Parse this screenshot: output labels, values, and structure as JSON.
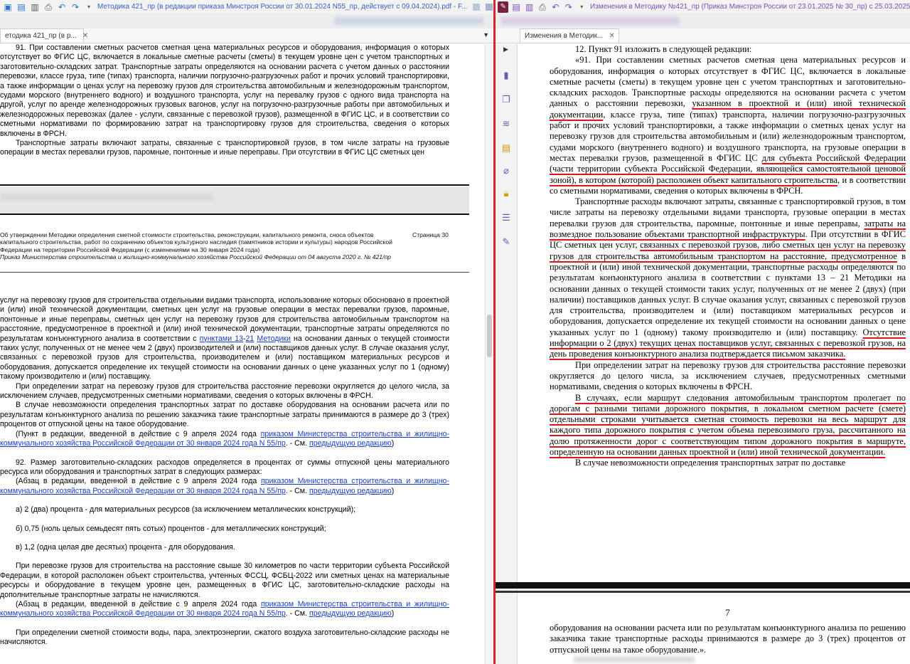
{
  "left": {
    "window_title": "Методика 421_пр (в редакции приказа Минстроя России от 30.01.2024 N55_пр, действует с 09.04.2024).pdf - F...",
    "tab_label": "етодика 421_пр (в р...",
    "page_top": {
      "p1": "91. При составлении сметных расчетов сметная цена материальных ресурсов и оборудования, информация о которых отсутствует во ФГИС ЦС, включается в локальные сметные расчеты (сметы) в текущем уровне цен с учетом транспортных и заготовительно-складских затрат. Транспортные затраты определяются на основании расчета с учетом данных о расстоянии перевозки, классе груза, типе (типах) транспорта, наличии погрузочно-разгрузочных работ и прочих условий транспортировки, а также информации о ценах услуг на перевозку грузов для строительства автомобильным и железнодорожным транспортом, судами морского (внутреннего водного) и воздушного транспорта, услуг на перевалку грузов с одного вида транспорта на другой, услуг по аренде железнодорожных грузовых вагонов, услуг на погрузочно-разгрузочные работы при автомобильных и железнодорожных перевозках (далее - услуги, связанные с перевозкой грузов), размещенной в ФГИС ЦС, и в соответствии со сметными нормативами по формированию затрат на транспортировку грузов для строительства, сведения о которых включены в ФРСН.",
      "p2": "Транспортные затраты включают затраты, связанные с транспортировкой грузов, в том числе затраты на грузовые операции в местах перевалки грузов, паромные, понтонные и иные переправы. При отсутствии в ФГИС ЦС сметных цен"
    },
    "header": {
      "line1": "Об утверждении Методики определения сметной стоимости строительства, реконструкции, капитального ремонта, сноса объектов капитального строительства, работ по сохранению объектов культурного наследия (памятников истории и культуры) народов Российской Федерации на территории Российской Федерации (с изменениями на 30 января 2024 года)",
      "page": "Страница 30",
      "line2": "Приказ Министерства строительства и жилищно-коммунального хозяйства Российской Федерации от 04 августа 2020 г. № 421/пр"
    },
    "body": {
      "p1_a": "услуг на перевозку грузов для строительства отдельными видами транспорта, использование которых обосновано в проектной и (или) иной технической документации, сметных цен услуг на грузовые операции в местах перевалки грузов, паромные, понтонные и иные переправы, сметных цен услуг на перевозку грузов для строительства автомобильным транспортом на расстояние, предусмотренное в проектной и (или) иной технической документации, транспортные затраты определяются по результатам конъюнктурного анализа в соответствии с ",
      "p1_link1": "пунктами 13",
      "p1_dash": "-",
      "p1_link2": "21",
      "p1_link3": "Методики",
      "p1_b": " на основании данных о текущей стоимости таких услуг, полученных от не менее чем 2 (двух) производителей и (или) поставщиков данных услуг. В случае оказания услуг, связанных с перевозкой грузов для строительства, производителем и (или) поставщиком материальных ресурсов и оборудования, допускается определение их текущей стоимости на основании данных о цене указанных услуг по 1 (одному) такому производителю и (или) поставщику.",
      "p2": "При определении затрат на перевозку грузов для строительства расстояние перевозки округляется до целого числа, за исключением случаев, предусмотренных сметными нормативами, сведения о которых включены в ФРСН.",
      "p3": "В случае невозможности определения транспортных затрат по доставке оборудования на основании расчета или по результатам конъюнктурного анализа по решению заказчика такие транспортные затраты принимаются в размере до 3 (трех) процентов от отпускной цены на такое оборудование.",
      "note1_a": "(Пункт в редакции, введенной в действие с 9 апреля 2024 года ",
      "note1_link": "приказом Министерства строительства и жилищно-коммунального хозяйства Российской Федерации от 30 января 2024 года N 55/пр",
      "note1_b": ". - См. ",
      "note1_link2": "предыдущую редакцию",
      "note1_c": ")",
      "p92": "92. Размер заготовительно-складских расходов определяется в процентах от суммы отпускной цены материального ресурса или оборудования и транспортных затрат в следующих размерах:",
      "note2_a": "(Абзац в редакции, введенной в действие с 9 апреля 2024 года ",
      "note2_link": "приказом Министерства строительства и жилищно-коммунального хозяйства Российской Федерации от 30 января 2024 года N 55/пр",
      "note2_b": ". - См. ",
      "note2_link2": "предыдущую редакцию",
      "note2_c": ")",
      "ia": "а) 2 (два) процента - для материальных ресурсов (за исключением металлических конструкций);",
      "ib": "б) 0,75 (ноль целых семьдесят пять сотых) процентов - для металлических конструкций;",
      "iv": "в) 1,2 (одна целая две десятых) процента - для оборудования.",
      "p4": "При перевозке грузов для строительства на расстояние свыше 30 километров по части территории субъекта Российской Федерации, в которой расположен объект строительства, учтенных ФССЦ, ФСБЦ-2022 или сметных ценах на материальные ресурсы и оборудование в текущем уровне цен, размещенных в ФГИС ЦС, заготовительно-складские расходы на дополнительные транспортные затраты не начисляются.",
      "note3_a": "(Абзац в редакции, введенной в действие с 9 апреля 2024 года ",
      "note3_link": "приказом Министерства строительства и жилищно-коммунального хозяйства Российской Федерации от 30 января 2024 года N 55/пр",
      "note3_b": ". - См. ",
      "note3_link2": "предыдущую редакцию",
      "note3_c": ")",
      "p5": "При определении сметной стоимости воды, пара, электроэнергии, сжатого воздуха заготовительно-складские расходы не начисляются."
    }
  },
  "right": {
    "window_title": "Изменения в Методику №421_пр (Приказ Минстроя России от 23.01.2025 № 30_пр) с 25.03.2025.pdf",
    "tab_label": "Изменения в Методик...",
    "text": {
      "h12": "12. Пункт 91 изложить в следующей редакции:",
      "a1": "«91. При составлении сметных расчетов сметная цена материальных ресурсов и оборудования, информация о которых отсутствует в ФГИС ЦС, включается в локальные сметные расчеты (сметы) в текущем уровне цен с учетом транспортных и заготовительно-складских расходов. Транспортные расходы определяются на основании расчета с учетом данных о расстоянии перевозки, ",
      "u1": "указанном в проектной и (или) иной технической документации",
      "a2": ", классе груза, типе (типах) транспорта, наличии погрузочно-разгрузочных работ и прочих условий транспортировки, а также информации о сметных ценах услуг на перевозку грузов для строительства автомобильным и (или) железнодорожным транспортом, судами морского (внутреннего водного) и воздушного транспорта, на грузовые операции в местах перевалки грузов, размещенной в ФГИС ЦС ",
      "u2": "для субъекта Российской Федерации (части территории субъекта Российской Федерации, являющейся самостоятельной ценовой зоной), в котором (которой) расположен объект капитального строительства",
      "a3": ", и в соответствии со сметными нормативами, сведения о которых включены в ФРСН.",
      "b1": "Транспортные расходы включают затраты, связанные с транспортировкой грузов, в том числе затраты на перевозку отдельными видами транспорта, грузовые операции в местах перевалки грузов для строительства, паромные, понтонные и иные переправы, ",
      "u3": "затраты на возмездное пользование объектами транспортной инфраструктуры",
      "b2": ". При отсутствии в ФГИС ЦС сметных цен услуг, ",
      "u4": "связанных с перевозкой грузов, либо сметных цен услуг на перевозку грузов для строительства автомобильным транспортом на расстояние, предусмотренное",
      "b3": " в проектной и (или) иной технической документации, транспортные расходы определяются по результатам конъюнктурного анализа в соответствии с пунктами 13 – 21 Методики на основании данных о текущей стоимости таких услуг, полученных от не менее 2 (двух) (при наличии) поставщиков данных услуг. В случае оказания услуг, связанных с перевозкой грузов для строительства, производителем и (или) поставщиком материальных ресурсов и оборудования, допускается определение их текущей стоимости на основании данных о цене указанных услуг по 1 (одному) такому производителю и (или) поставщику. ",
      "u5": "Отсутствие информации о 2 (двух) текущих ценах поставщиков услуг, связанных с перевозкой грузов, на день проведения конъюнктурного анализа подтверждается письмом заказчика.",
      "c1": "При определении затрат на перевозку грузов для строительства расстояние перевозки округляется до целого числа, за исключением случаев, предусмотренных сметными нормативами, сведения о которых включены в ФРСН.",
      "u6": "В случаях, если маршрут следования автомобильным транспортом пролегает по дорогам с разными типами дорожного покрытия, в локальном сметном расчете (смете) отдельными строками учитывается сметная стоимость перевозки на весь маршрут для каждого типа дорожного покрытия с учетом объема перевозимого груза, рассчитанного на долю протяженности дорог с соответствующим типом дорожного покрытия в маршруте, определенную на основании данных проектной и (или) иной технической документации.",
      "d1": "В случае невозможности определения транспортных затрат по доставке",
      "page_number": "7",
      "e1": "оборудования на основании расчета или по результатам конъюнктурного анализа по решению заказчика такие транспортные расходы принимаются в размере до 3 (трех) процентов от отпускной цены на такое оборудование.»."
    }
  },
  "colors": {
    "underline": "#e0141b",
    "link": "#1a3fc7",
    "divider": "#d8252b"
  },
  "icons": [
    "new-doc-icon",
    "save-icon",
    "open-icon",
    "print-icon",
    "undo-icon",
    "redo-icon",
    "menu-icon",
    "bookmarks-icon",
    "pages-icon",
    "layers-icon",
    "comments-icon",
    "attachments-icon",
    "security-icon",
    "forms-icon",
    "sign-icon",
    "pdf-app-icon"
  ]
}
